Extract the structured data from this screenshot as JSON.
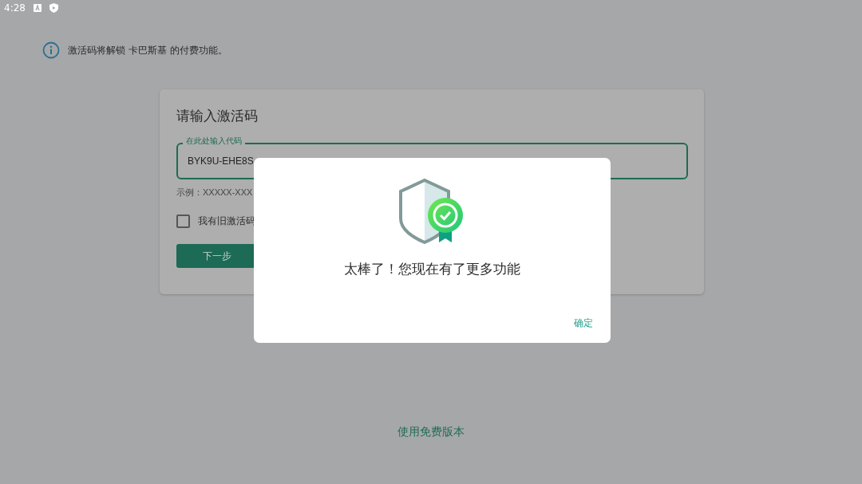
{
  "status_bar": {
    "time": "4:28"
  },
  "notice": {
    "text": "激活码将解锁 卡巴斯基 的付费功能。"
  },
  "card": {
    "title": "请输入激活码",
    "field": {
      "label": "在此处输入代码",
      "value": "BYK9U-EHE8S"
    },
    "hint": "示例：XXXXX-XXX",
    "checkbox": {
      "label": "我有旧激活码",
      "checked": false
    },
    "button": "下一步"
  },
  "dialog": {
    "message": "太棒了！您现在有了更多功能",
    "button": "确定"
  },
  "footer_link": "使用免费版本"
}
